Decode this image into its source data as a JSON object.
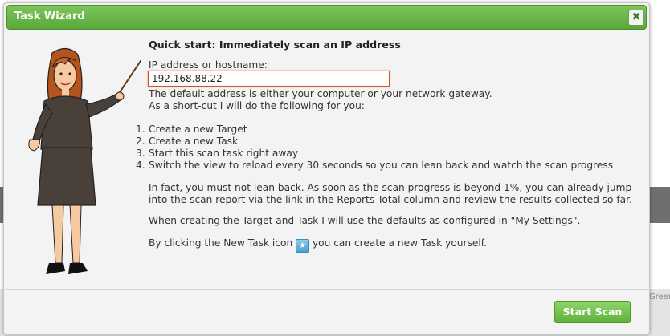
{
  "background": {
    "side_text": "Green"
  },
  "dialog": {
    "title": "Task Wizard",
    "close_symbol": "✖",
    "heading": "Quick start: Immediately scan an IP address",
    "ip_label": "IP address or hostname:",
    "ip_value": "192.168.88.22",
    "default_note": "The default address is either your computer or your network gateway.",
    "shortcut_note": "As a short-cut I will do the following for you:",
    "steps": [
      {
        "num": "1.",
        "text": "Create a new Target"
      },
      {
        "num": "2.",
        "text": "Create a new Task"
      },
      {
        "num": "3.",
        "text": "Start this scan task right away"
      },
      {
        "num": "4.",
        "text": "Switch the view to reload every 30 seconds so you can lean back and watch the scan progress"
      }
    ],
    "lean_back_note": "In fact, you must not lean back. As soon as the scan progress is beyond 1%, you can already jump into the scan report via the link in the Reports Total column and review the results collected so far.",
    "defaults_note": "When creating the Target and Task I will use the defaults as configured in \"My Settings\".",
    "new_task_prefix": "By clicking the New Task icon",
    "new_task_suffix": "you can create a new Task yourself.",
    "start_button": "Start Scan"
  },
  "colors": {
    "titlebar": "#6bb94a",
    "button": "#74c34f",
    "input_focus": "#d4561c"
  }
}
